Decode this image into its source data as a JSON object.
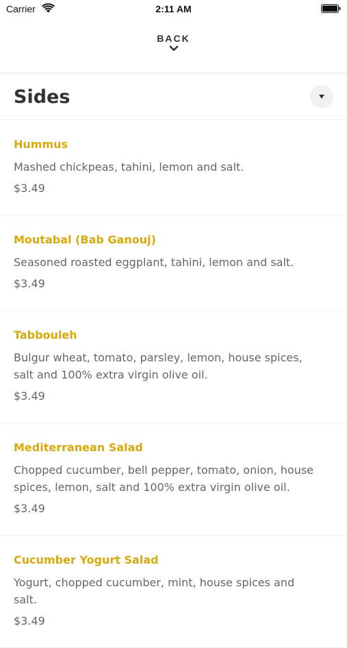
{
  "status_bar": {
    "carrier": "Carrier",
    "time": "2:11 AM"
  },
  "nav": {
    "back_label": "BACK"
  },
  "section": {
    "title": "Sides"
  },
  "items": [
    {
      "name": "Hummus",
      "description": "Mashed chickpeas, tahini, lemon and salt.",
      "price": "$3.49"
    },
    {
      "name": "Moutabal (Bab Ganouj)",
      "description": "Seasoned roasted eggplant, tahini, lemon and salt.",
      "price": "$3.49"
    },
    {
      "name": "Tabbouleh",
      "description": "Bulgur wheat, tomato, parsley, lemon, house spices, salt and 100% extra virgin olive oil.",
      "price": "$3.49"
    },
    {
      "name": "Mediterranean Salad",
      "description": "Chopped cucumber, bell pepper, tomato, onion, house spices, lemon, salt and 100% extra virgin olive oil.",
      "price": "$3.49"
    },
    {
      "name": "Cucumber Yogurt Salad",
      "description": "Yogurt, chopped cucumber, mint, house spices and salt.",
      "price": "$3.49"
    }
  ],
  "colors": {
    "item_name": "#d9a90b",
    "text": "#666666",
    "title": "#333333"
  }
}
